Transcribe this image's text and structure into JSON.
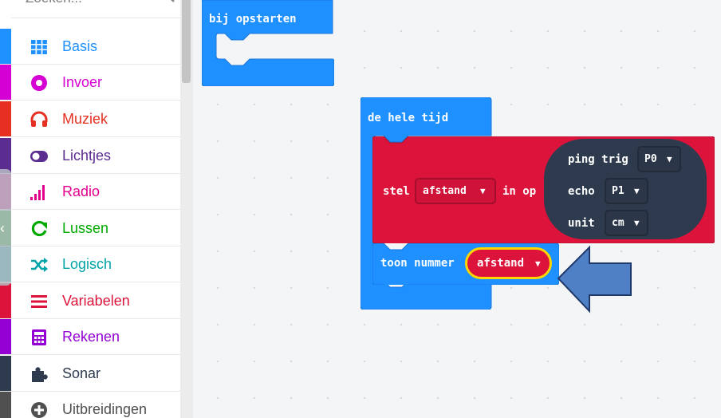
{
  "search": {
    "placeholder": "Zoeken..."
  },
  "categories": [
    {
      "label": "Basis",
      "color": "#1e90ff",
      "icon": "grid-icon"
    },
    {
      "label": "Invoer",
      "color": "#d400d4",
      "icon": "circle-dot-icon"
    },
    {
      "label": "Muziek",
      "color": "#e63022",
      "icon": "headphones-icon"
    },
    {
      "label": "Lichtjes",
      "color": "#5c2d91",
      "icon": "toggle-icon"
    },
    {
      "label": "Radio",
      "color": "#e3008c",
      "icon": "signal-bars-icon"
    },
    {
      "label": "Lussen",
      "color": "#00aa00",
      "icon": "refresh-icon"
    },
    {
      "label": "Logisch",
      "color": "#00a4a6",
      "icon": "shuffle-icon"
    },
    {
      "label": "Variabelen",
      "color": "#dc143c",
      "icon": "list-lines-icon"
    },
    {
      "label": "Rekenen",
      "color": "#9400d3",
      "icon": "calculator-icon"
    },
    {
      "label": "Sonar",
      "color": "#2e3b4e",
      "icon": "puzzle-icon"
    },
    {
      "label": "Uitbreidingen",
      "color": "#505050",
      "icon": "plus-circle-icon"
    }
  ],
  "blocks": {
    "on_start": {
      "label": "bij opstarten",
      "color": "#1e90ff"
    },
    "forever": {
      "label": "de hele tijd",
      "color": "#1e90ff"
    },
    "set_var": {
      "stel": "stel",
      "var": "afstand",
      "in_op": "in op",
      "color": "#dc143c"
    },
    "ping": {
      "ping_trig": "ping trig",
      "trig_pin": "P0",
      "echo": "echo",
      "echo_pin": "P1",
      "unit": "unit",
      "unit_value": "cm",
      "color": "#2e3b4e"
    },
    "show_number": {
      "label": "toon nummer",
      "var": "afstand",
      "color": "#1e90ff",
      "highlight": "#ffd700"
    }
  },
  "annotation": {
    "arrow_color": "#4f7fc4"
  }
}
